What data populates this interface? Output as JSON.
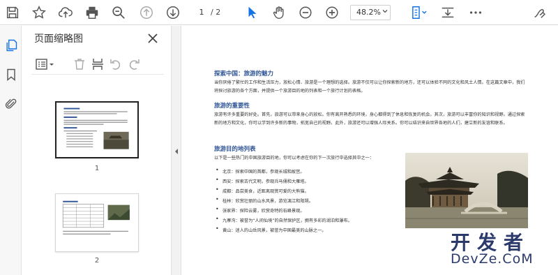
{
  "toolbar": {
    "page_current": "1",
    "page_total": "/ 2",
    "zoom": "48.2%",
    "icons": [
      "save-icon",
      "star-icon",
      "upload-icon",
      "print-icon",
      "zoom-out-magnifier-icon",
      "prev-page-icon",
      "next-page-icon",
      "select-cursor-icon",
      "hand-icon",
      "minus-circle-icon",
      "plus-circle-icon",
      "fit-page-icon",
      "read-mode-icon",
      "more-icon",
      "sign-icon"
    ]
  },
  "rail": {
    "icons": [
      "thumbnails-icon",
      "bookmark-icon",
      "attachment-icon"
    ]
  },
  "panel": {
    "title": "页面缩略图",
    "thumbnails": [
      {
        "number": "1",
        "selected": true
      },
      {
        "number": "2",
        "selected": false
      }
    ]
  },
  "document": {
    "h1": "探索中国：旅游的魅力",
    "p1": "当你厌倦了繁忙的工作和生活压力，放松心情、旅游是一个理想的选择。旅游不仅可以让你探索新的地方，还可以体验不同的文化和风土人情。在这篇文章中，我们将探讨旅游的各个方面，并提供一个旅游目的地的列表和一个旅行计划的表格。",
    "h2": "旅游的重要性",
    "p2": "旅游有许多重要的好处。首先，旅游可以带来身心的放松。你有离开熟悉的环境，身心都得到了休息和恢复的机会。其次，旅游可以丰富你的知识和视野。通过探索新的地方和文化，你可以学到许多新的事物，拓宽自己的视野。此外，旅游还可以增强人际关系。你可以结识来自世界各地的人们，建立新的友谊和联系。",
    "h3": "旅游目的地列表",
    "p3": "以下是一些热门的中国旅游目的地，你可以考虑在你的下一次旅行中选择其中之一：",
    "list": [
      "北京：探索中国的首都，参观长城和故宫。",
      "西安：探索古代文明，参观兵马俑和大雁塔。",
      "成都：品尝美食，近距离观赏可爱的大熊猫。",
      "桂林：欣赏壮丽的山水风景，游览漓江和阳朔。",
      "张家界：探险云雾，欣赏奇特的石峰景观。",
      "九寨沟：被誉为“人间仙境”的自然保护区，拥有多彩的湖泊和瀑布。",
      "黄山：迷人的山岳风景，被誉为中国最美的山脉之一。"
    ]
  },
  "watermark": {
    "cn": "开发者",
    "en": "DevZe.CoM"
  },
  "colors": {
    "accent": "#2f5597",
    "toolbar_icon": "#444444",
    "cursor_active": "#1473e6"
  }
}
